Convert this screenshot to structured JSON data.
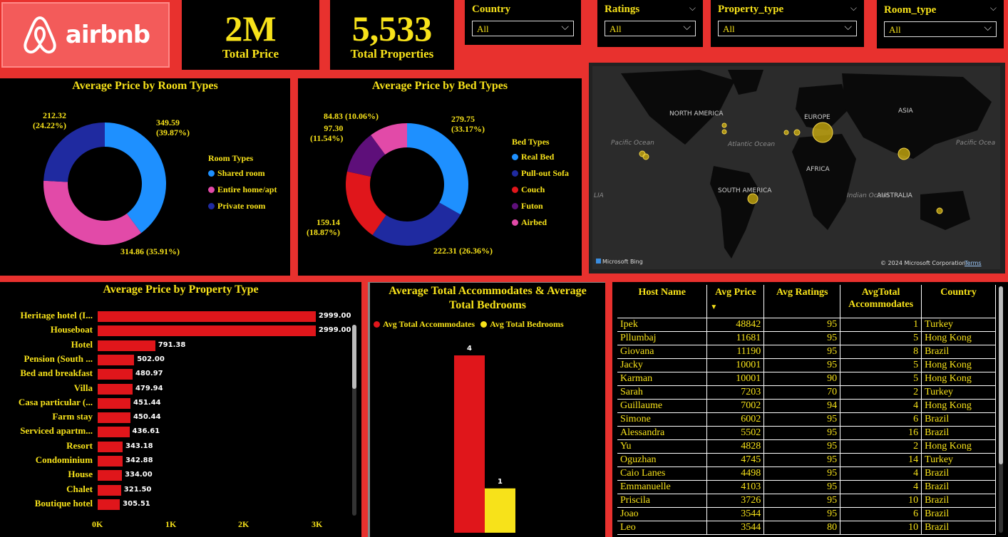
{
  "brand": {
    "name": "airbnb"
  },
  "kpis": {
    "total_price": {
      "value": "2M",
      "label": "Total Price"
    },
    "total_properties": {
      "value": "5,533",
      "label": "Total Properties"
    }
  },
  "slicers": [
    {
      "title": "Country",
      "value": "All"
    },
    {
      "title": "Ratings",
      "value": "All"
    },
    {
      "title": "Property_type",
      "value": "All"
    },
    {
      "title": "Room_type",
      "value": "All"
    }
  ],
  "map": {
    "labels": [
      "NORTH AMERICA",
      "EUROPE",
      "ASIA",
      "AFRICA",
      "SOUTH AMERICA",
      "AUSTRALIA"
    ],
    "oceans": [
      "Pacific Ocean",
      "Atlantic Ocean",
      "Indian Ocean",
      "Pacific Ocea",
      "LIA"
    ],
    "attribution_left": "Microsoft Bing",
    "attribution_right": "© 2024 Microsoft Corporation",
    "terms": "Terms",
    "point_color": "#d4b40f"
  },
  "chart_data": [
    {
      "type": "pie",
      "title": "Average Price by Room Types",
      "legend_title": "Room Types",
      "legend_placement": "right",
      "slices": [
        {
          "name": "Shared room",
          "value": 349.59,
          "label": "349.59",
          "pct": "(39.87%)",
          "color": "#1e90ff"
        },
        {
          "name": "Entire home/apt",
          "value": 314.86,
          "label": "314.86 (35.91%)",
          "pct": "",
          "color": "#e24aa8"
        },
        {
          "name": "Private room",
          "value": 212.32,
          "label": "212.32",
          "pct": "(24.22%)",
          "color": "#1f2aa0"
        }
      ]
    },
    {
      "type": "pie",
      "title": "Average Price by Bed Types",
      "legend_title": "Bed Types",
      "legend_placement": "right",
      "slices": [
        {
          "name": "Real Bed",
          "value": 279.75,
          "label": "279.75",
          "pct": "(33.17%)",
          "color": "#1e90ff"
        },
        {
          "name": "Pull-out Sofa",
          "value": 222.31,
          "label": "222.31 (26.36%)",
          "pct": "",
          "color": "#1f2aa0"
        },
        {
          "name": "Couch",
          "value": 159.14,
          "label": "159.14",
          "pct": "(18.87%)",
          "color": "#e0161b"
        },
        {
          "name": "Futon",
          "value": 97.3,
          "label": "97.30",
          "pct": "(11.54%)",
          "color": "#5e0f7a"
        },
        {
          "name": "Airbed",
          "value": 84.83,
          "label": "84.83 (10.06%)",
          "pct": "",
          "color": "#e24aa8"
        }
      ]
    },
    {
      "type": "bar",
      "orientation": "horizontal",
      "title": "Average Price by Property Type",
      "xlim": [
        0,
        3000
      ],
      "ticks": [
        "0K",
        "1K",
        "2K",
        "3K"
      ],
      "categories": [
        "Heritage hotel (I...",
        "Houseboat",
        "Hotel",
        "Pension (South ...",
        "Bed and breakfast",
        "Villa",
        "Casa particular (...",
        "Farm stay",
        "Serviced apartm...",
        "Resort",
        "Condominium",
        "House",
        "Chalet",
        "Boutique hotel"
      ],
      "values": [
        2999.0,
        2999.0,
        791.38,
        502.0,
        480.97,
        479.94,
        451.44,
        450.44,
        436.61,
        343.18,
        342.88,
        334.0,
        321.5,
        305.51
      ],
      "labels": [
        "2999.00",
        "2999.00",
        "791.38",
        "502.00",
        "480.97",
        "479.94",
        "451.44",
        "450.44",
        "436.61",
        "343.18",
        "342.88",
        "334.00",
        "321.50",
        "305.51"
      ],
      "color": "#e0161b"
    },
    {
      "type": "bar",
      "title": "Average Total Accommodates & Average Total Bedrooms",
      "title_line1": "Average Total Accommodates & Average",
      "title_line2": "Total Bedrooms",
      "series": [
        {
          "name": "Avg Total Accommodates",
          "values": [
            4
          ],
          "label": "4",
          "color": "#e0161b"
        },
        {
          "name": "Avg  Total Bedrooms",
          "values": [
            1
          ],
          "label": "1",
          "color": "#f7e21a"
        }
      ],
      "ylim": [
        0,
        4
      ]
    }
  ],
  "table": {
    "columns": [
      "Host Name",
      "Avg Price",
      "Avg Ratings",
      "AvgTotal Accommodates",
      "Country"
    ],
    "sort_indicator": "▼",
    "rows": [
      [
        "Ipek",
        "48842",
        "95",
        "1",
        "Turkey"
      ],
      [
        "Pllumbaj",
        "11681",
        "95",
        "5",
        "Hong Kong"
      ],
      [
        "Giovana",
        "11190",
        "95",
        "8",
        "Brazil"
      ],
      [
        "Jacky",
        "10001",
        "95",
        "5",
        "Hong Kong"
      ],
      [
        "Karman",
        "10001",
        "90",
        "5",
        "Hong Kong"
      ],
      [
        "Sarah",
        "7203",
        "70",
        "2",
        "Turkey"
      ],
      [
        "Guillaume",
        "7002",
        "94",
        "4",
        "Hong Kong"
      ],
      [
        "Simone",
        "6002",
        "95",
        "6",
        "Brazil"
      ],
      [
        "Alessandra",
        "5502",
        "95",
        "16",
        "Brazil"
      ],
      [
        "Yu",
        "4828",
        "95",
        "2",
        "Hong Kong"
      ],
      [
        "Oguzhan",
        "4745",
        "95",
        "14",
        "Turkey"
      ],
      [
        "Caio Lanes",
        "4498",
        "95",
        "4",
        "Brazil"
      ],
      [
        "Emmanuelle",
        "4103",
        "95",
        "4",
        "Brazil"
      ],
      [
        "Priscila",
        "3726",
        "95",
        "10",
        "Brazil"
      ],
      [
        "Joao",
        "3544",
        "95",
        "6",
        "Brazil"
      ],
      [
        "Leo",
        "3544",
        "80",
        "10",
        "Brazil"
      ]
    ]
  },
  "colors": {
    "background": "#e8312e",
    "accent_text": "#f7e21a",
    "panel": "#000000"
  }
}
